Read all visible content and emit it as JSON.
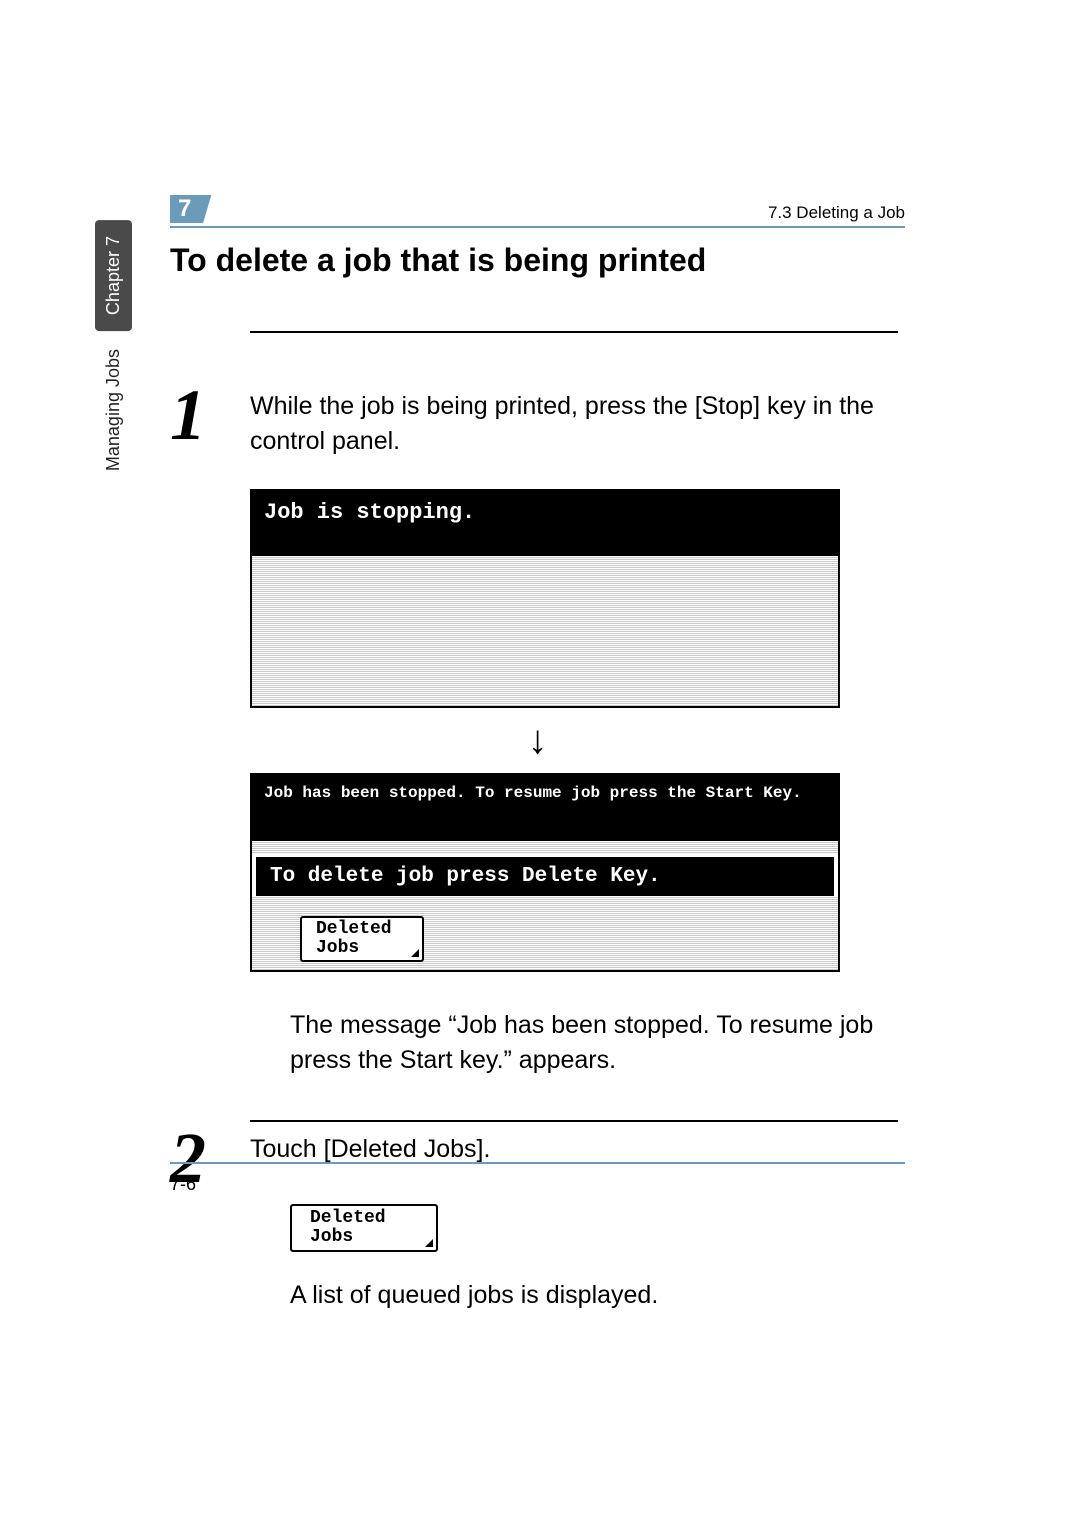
{
  "sidebar": {
    "chapter_tab": "Chapter 7",
    "section_name": "Managing Jobs"
  },
  "header": {
    "chapter_number": "7",
    "running_head": "7.3 Deleting a Job"
  },
  "title": "To delete a job that is being printed",
  "steps": [
    {
      "number": "1",
      "text": "While the job is being printed, press the [Stop] key in the control panel.",
      "screen1_header": "Job is stopping.",
      "screen2_header": "Job has been stopped. To resume job press the Start Key.",
      "screen2_msg": "To delete job press Delete Key.",
      "button_label": "Deleted\nJobs",
      "followup": "The message “Job has been stopped. To resume job press the Start key.” appears."
    },
    {
      "number": "2",
      "text": "Touch [Deleted Jobs].",
      "button_label": "Deleted\nJobs",
      "followup": "A list of queued jobs is displayed."
    }
  ],
  "footer": {
    "page_number": "7-6"
  }
}
